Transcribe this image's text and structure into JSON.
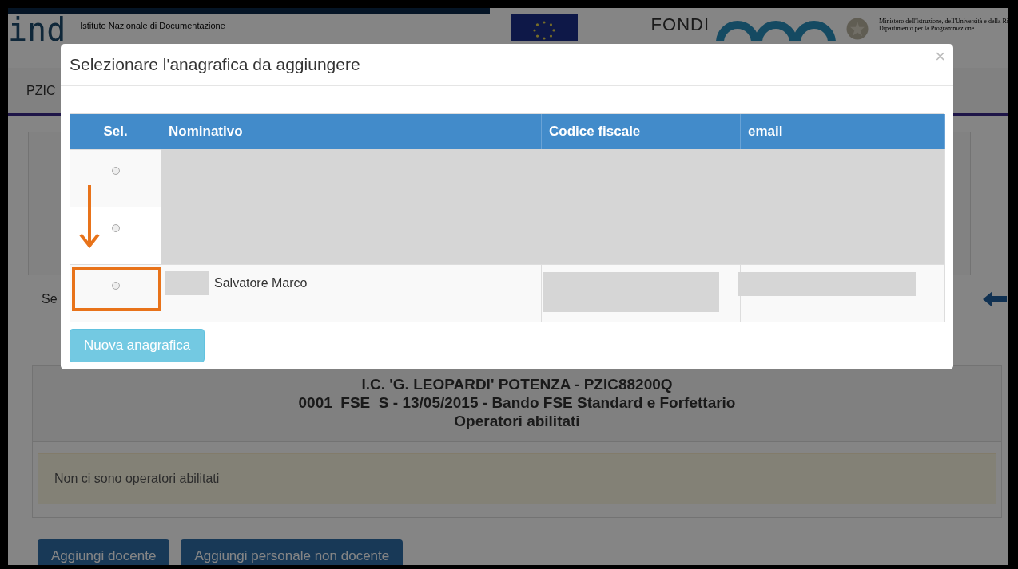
{
  "page": {
    "logo": "ind",
    "logo_subtitle": "Istituto Nazionale di Documentazione",
    "fondi": "FONDI",
    "ministry_lines": [
      "Ministero dell'Istruzione, dell'Università e della Ri",
      "Dipartimento per la Programmazione"
    ],
    "nav_tab": "PZIC",
    "section_label": "Se",
    "panel_title_lines": [
      "I.C. 'G. LEOPARDI' POTENZA - PZIC88200Q",
      "0001_FSE_S - 13/05/2015 - Bando FSE Standard e Forfettario",
      "Operatori abilitati"
    ],
    "alert": "Non ci sono operatori abilitati",
    "buttons": [
      "Aggiungi docente",
      "Aggiungi personale non docente"
    ]
  },
  "modal": {
    "title": "Selezionare l'anagrafica da aggiungere",
    "close": "×",
    "columns": [
      "Sel.",
      "Nominativo",
      "Codice fiscale",
      "email"
    ],
    "rows": [
      {
        "kind": "redacted",
        "selected": false
      },
      {
        "kind": "redacted",
        "selected": false
      },
      {
        "kind": "partial",
        "name": "Salvatore Marco",
        "selected": false,
        "highlighted": true
      }
    ],
    "button": "Nuova anagrafica"
  }
}
